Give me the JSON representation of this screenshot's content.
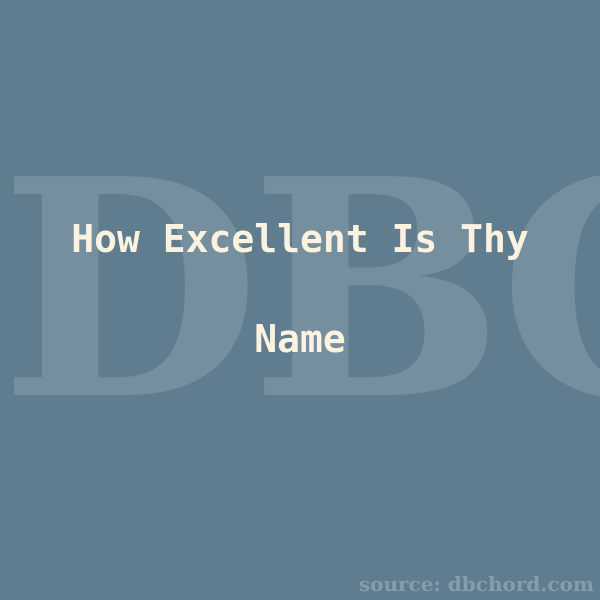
{
  "background": {
    "color": "#5f7d8f"
  },
  "watermark": {
    "text": "DBC"
  },
  "title": {
    "line1": "How Excellent Is Thy",
    "line2": "Name"
  },
  "footer": {
    "source": "source: dbchord.com"
  },
  "colors": {
    "title_text": "#fbf3df"
  }
}
